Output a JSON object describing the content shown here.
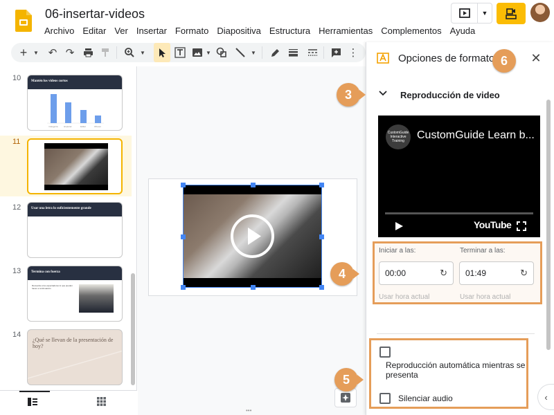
{
  "app": {
    "title": "06-insertar-videos"
  },
  "menu": [
    "Archivo",
    "Editar",
    "Ver",
    "Insertar",
    "Formato",
    "Diapositiva",
    "Estructura",
    "Herramientas",
    "Complementos",
    "Ayuda"
  ],
  "toolbar": [
    "plus-icon",
    "undo-icon",
    "redo-icon",
    "print-icon",
    "paint-format-icon",
    "zoom-icon",
    "select-icon",
    "textbox-icon",
    "image-icon",
    "shape-icon",
    "line-icon",
    "pen-icon",
    "line-weight-icon",
    "line-dash-icon",
    "add-comment-icon"
  ],
  "filmstrip": {
    "slides": [
      {
        "num": "10",
        "title": "Mantén los videos cortos",
        "bars": [
          {
            "label": "Categoría",
            "value": 0.95
          },
          {
            "label": "Explorar",
            "value": 0.68
          },
          {
            "label": "Editar",
            "value": 0.42
          },
          {
            "label": "Ofrecer",
            "value": 0.25
          }
        ]
      },
      {
        "num": "11",
        "selected": true
      },
      {
        "num": "12",
        "title": "Usar una letra lo suficientemente grande"
      },
      {
        "num": "13",
        "title": "Termina con fuerza",
        "body": "Recuerda a los espectadores lo que pueden hacer a continuación"
      },
      {
        "num": "14",
        "title": "¿Qué se llevan de la presentación de hoy?"
      }
    ]
  },
  "panel": {
    "title": "Opciones de formato",
    "section": "Reproducción de video",
    "video": {
      "title": "CustomGuide Learn b...",
      "logo": "CustomGuide Interactive Training",
      "brand": "YouTube"
    },
    "start": {
      "label": "Iniciar a las:",
      "value": "00:00",
      "link": "Usar hora actual"
    },
    "end": {
      "label": "Terminar a las:",
      "value": "01:49",
      "link": "Usar hora actual"
    },
    "autoplay_label": "Reproducción automática mientras se presenta",
    "mute_label": "Silenciar audio"
  },
  "callouts": [
    "3",
    "4",
    "5",
    "6"
  ],
  "colors": {
    "callout": "#e59d59",
    "accent": "#fbbc04",
    "selection": "#4285f4"
  }
}
